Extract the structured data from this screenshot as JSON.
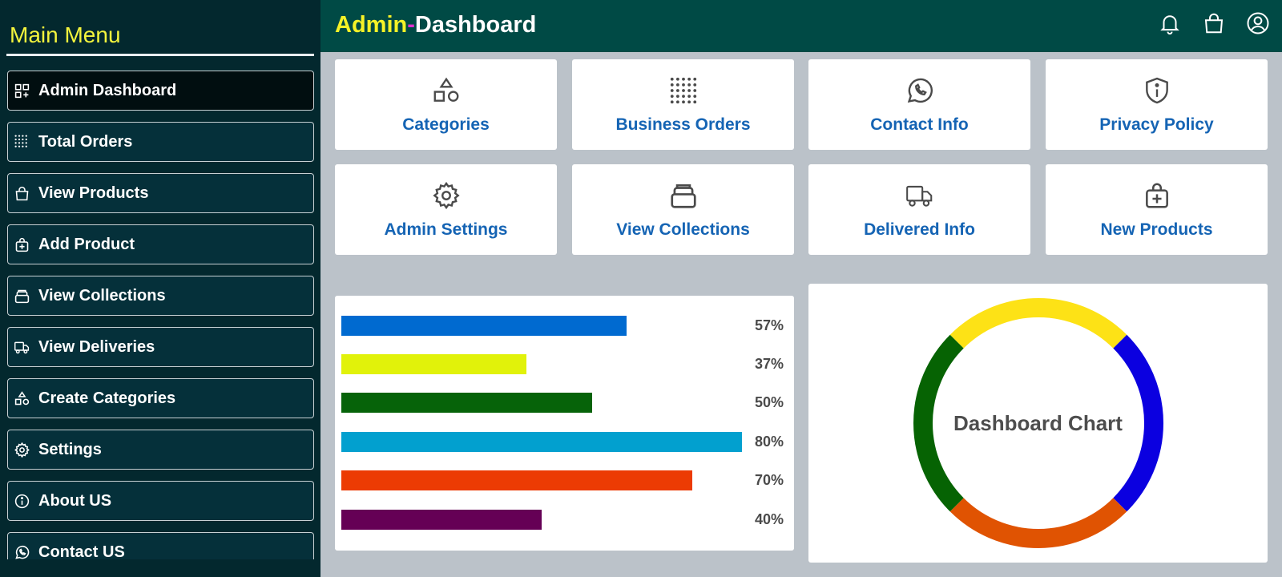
{
  "sidebar": {
    "title": "Main Menu",
    "items": [
      {
        "label": "Admin Dashboard",
        "icon": "dashboard-grid-icon",
        "active": true
      },
      {
        "label": "Total Orders",
        "icon": "dot-grid-icon",
        "active": false
      },
      {
        "label": "View Products",
        "icon": "shopping-bag-icon",
        "active": false
      },
      {
        "label": "Add Product",
        "icon": "bag-plus-icon",
        "active": false
      },
      {
        "label": "View Collections",
        "icon": "stack-icon",
        "active": false
      },
      {
        "label": "View Deliveries",
        "icon": "truck-icon",
        "active": false
      },
      {
        "label": "Create Categories",
        "icon": "shapes-icon",
        "active": false
      },
      {
        "label": "Settings",
        "icon": "gear-icon",
        "active": false
      },
      {
        "label": "About US",
        "icon": "info-icon",
        "active": false
      },
      {
        "label": "Contact US",
        "icon": "whatsapp-icon",
        "active": false
      }
    ]
  },
  "header": {
    "brand_part1": "Admin",
    "brand_separator": "-",
    "brand_part2": "Dashboard",
    "icons": [
      "bell-icon",
      "shopping-bag-icon",
      "user-circle-icon"
    ]
  },
  "tiles": [
    {
      "label": "Categories",
      "icon": "shapes-icon"
    },
    {
      "label": "Business Orders",
      "icon": "dot-grid-icon"
    },
    {
      "label": "Contact Info",
      "icon": "whatsapp-icon"
    },
    {
      "label": "Privacy Policy",
      "icon": "shield-info-icon"
    },
    {
      "label": "Admin Settings",
      "icon": "gear-icon"
    },
    {
      "label": "View Collections",
      "icon": "stack-icon"
    },
    {
      "label": "Delivered Info",
      "icon": "truck-icon"
    },
    {
      "label": "New Products",
      "icon": "bag-plus-icon"
    }
  ],
  "progress_bars": [
    {
      "label": "57%",
      "value": 57,
      "color": "#006ad0"
    },
    {
      "label": "37%",
      "value": 37,
      "color": "#e1f20a"
    },
    {
      "label": "50%",
      "value": 50,
      "color": "#066309"
    },
    {
      "label": "80%",
      "value": 80,
      "color": "#02a0cf"
    },
    {
      "label": "70%",
      "value": 70,
      "color": "#ec3b03"
    },
    {
      "label": "40%",
      "value": 40,
      "color": "#650055"
    }
  ],
  "donut": {
    "label": "Dashboard Chart",
    "segments": [
      {
        "color": "#fde216",
        "share": 0.25
      },
      {
        "color": "#0b00e0",
        "share": 0.25
      },
      {
        "color": "#e05302",
        "share": 0.25
      },
      {
        "color": "#066303",
        "share": 0.25
      }
    ]
  },
  "colors": {
    "sidebar_bg": "#03282e",
    "header_bg": "#004a45",
    "accent_yellow": "#f3f43d",
    "tile_text": "#1564b4",
    "content_bg": "#bbc2c9"
  }
}
